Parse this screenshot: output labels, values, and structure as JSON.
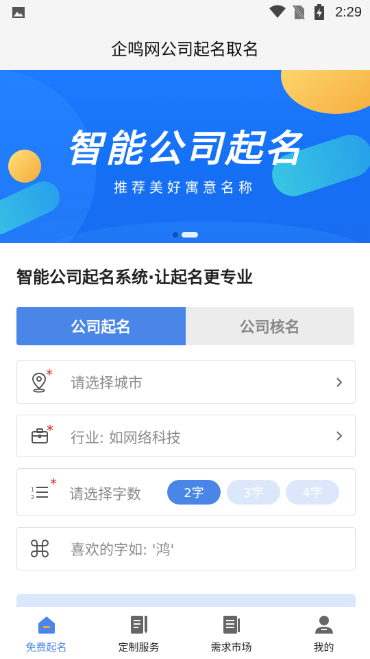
{
  "status": {
    "time": "2:29"
  },
  "app": {
    "title": "企鸣网公司起名取名"
  },
  "banner": {
    "title": "智能公司起名",
    "subtitle": "推荐美好寓意名称"
  },
  "section": {
    "title": "智能公司起名系统·让起名更专业"
  },
  "tabs": [
    {
      "label": "公司起名",
      "active": true
    },
    {
      "label": "公司核名",
      "active": false
    }
  ],
  "form": {
    "city_placeholder": "请选择城市",
    "industry_placeholder": "行业: 如网络科技",
    "count_label": "请选择字数",
    "count_options": [
      "2字",
      "3字",
      "4字"
    ],
    "count_selected": "2字",
    "fav_placeholder": "喜欢的字如: '鸿'"
  },
  "nav": [
    {
      "label": "免费起名",
      "icon": "home-icon",
      "active": true
    },
    {
      "label": "定制服务",
      "icon": "document-pen-icon",
      "active": false
    },
    {
      "label": "需求市场",
      "icon": "list-document-icon",
      "active": false
    },
    {
      "label": "我的",
      "icon": "person-icon",
      "active": false
    }
  ],
  "colors": {
    "accent": "#4a86e8",
    "banner": "#1a74f8",
    "required": "#e02020"
  }
}
